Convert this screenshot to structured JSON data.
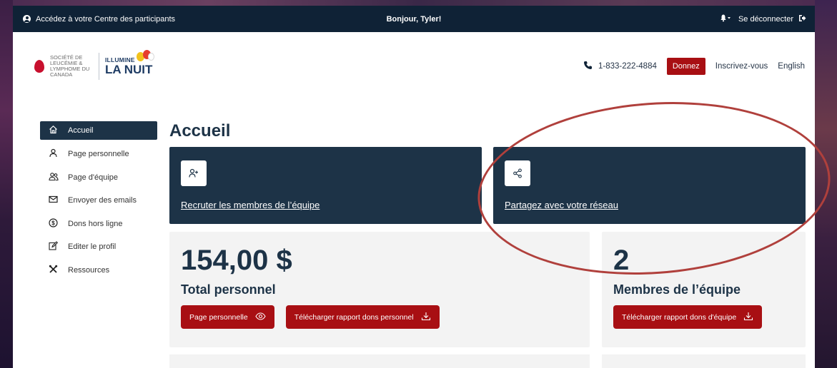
{
  "topbar": {
    "participant_center": "Accédez à votre Centre des participants",
    "greeting": "Bonjour, Tyler!",
    "logout": "Se déconnecter"
  },
  "header": {
    "logo_small": "SOCIÉTÉ DE LEUCÉMIE & LYMPHOME DU CANADA",
    "logo_line1": "ILLUMINE",
    "logo_line2": "LA NUIT",
    "phone": "1-833-222-4884",
    "donate": "Donnez",
    "register": "Inscrivez-vous",
    "language": "English"
  },
  "sidebar": {
    "items": [
      {
        "label": "Accueil",
        "icon": "home-icon"
      },
      {
        "label": "Page personnelle",
        "icon": "user-icon"
      },
      {
        "label": "Page d'équipe",
        "icon": "users-icon"
      },
      {
        "label": "Envoyer des emails",
        "icon": "envelope-icon"
      },
      {
        "label": "Dons hors ligne",
        "icon": "dollar-icon"
      },
      {
        "label": "Editer le profil",
        "icon": "edit-icon"
      },
      {
        "label": "Ressources",
        "icon": "tools-icon"
      }
    ]
  },
  "main": {
    "title": "Accueil",
    "card_recruit": "Recruter les membres de l’équipe",
    "card_share": "Partagez avec votre réseau",
    "personal_total": "154,00 $",
    "personal_label": "Total personnel",
    "btn_personal_page": "Page personnelle",
    "btn_personal_report": "Télécharger rapport dons personnel",
    "team_members_count": "2",
    "team_members_label": "Membres de l’équipe",
    "btn_team_report": "Télécharger rapport dons d'équipe"
  },
  "colors": {
    "navy": "#1d3347",
    "topbar": "#0f2236",
    "red": "#a80f13",
    "highlight": "#b0403c"
  }
}
